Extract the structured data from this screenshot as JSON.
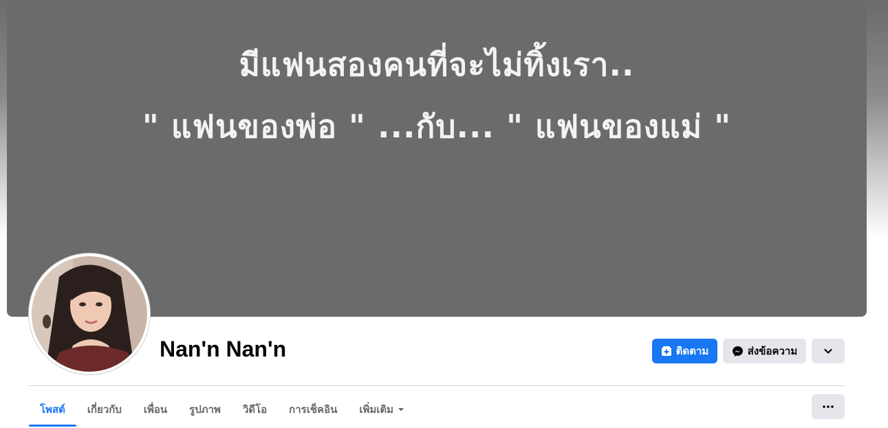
{
  "cover": {
    "line1": "มีแฟนสองคนที่จะไม่ทิ้งเรา..",
    "line2": "\" แฟนของพ่อ \" ...กับ... \" แฟนของแม่ \""
  },
  "profile": {
    "name": "Nan'n Nan'n"
  },
  "actions": {
    "follow_label": "ติดตาม",
    "message_label": "ส่งข้อความ"
  },
  "tabs": [
    {
      "label": "โพสต์",
      "active": true
    },
    {
      "label": "เกี่ยวกับ"
    },
    {
      "label": "เพื่อน"
    },
    {
      "label": "รูปภาพ"
    },
    {
      "label": "วิดีโอ"
    },
    {
      "label": "การเช็คอิน"
    },
    {
      "label": "เพิ่มเติม"
    }
  ],
  "icons": {
    "follow": "follow-add-icon",
    "message": "messenger-icon",
    "more": "chevron-down-icon",
    "tab_more_caret": "caret-down-icon",
    "tabs_menu": "ellipsis-icon"
  },
  "colors": {
    "accent": "#1877f2",
    "cover_bg": "#6b6b6b",
    "secondary_button": "#e4e6eb",
    "muted_text": "#65676b"
  }
}
